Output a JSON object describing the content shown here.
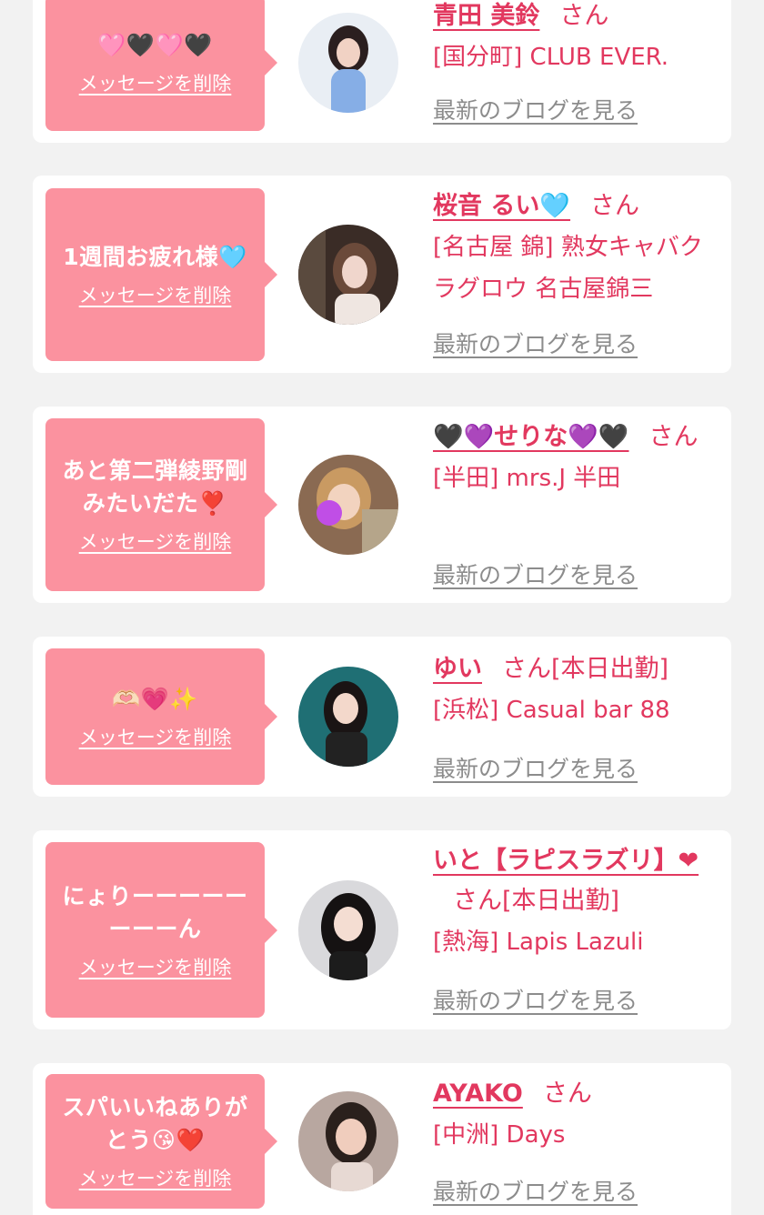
{
  "delete_label": "メッセージを削除",
  "blog_label": "最新のブログを見る",
  "honorific": "さん",
  "cards": [
    {
      "message": "🩷🖤🩷🖤",
      "name": "青田 美鈴",
      "attendance": "",
      "shop": "[国分町] CLUB EVER."
    },
    {
      "message": "1週間お疲れ様🩵",
      "name": "桜音 るい🩵",
      "attendance": "",
      "shop": "[名古屋 錦] 熟女キャバクラグロウ 名古屋錦三"
    },
    {
      "message": "あと第二弾綾野剛みたいだた❣️",
      "name": "🖤💜せりな💜🖤",
      "attendance": "",
      "shop": "[半田] mrs.J 半田"
    },
    {
      "message": "🫶🏻💗✨",
      "name": "ゆい",
      "attendance": "[本日出勤]",
      "shop": "[浜松] Casual bar 88"
    },
    {
      "message": "にょりーーーーーーーーん",
      "name": "いと【ラピスラズリ】❤",
      "attendance": "[本日出勤]",
      "shop": "[熱海] Lapis Lazuli"
    },
    {
      "message": "スパいいねありがとう😘❤️",
      "name": "AYAKO",
      "attendance": "",
      "shop": "[中洲] Days"
    }
  ],
  "colors": {
    "page_bg": "#f2f2f2",
    "card_bg": "#ffffff",
    "bubble_bg": "#fb929f",
    "accent": "#e2385f",
    "link_gray": "#8c8c8c"
  }
}
